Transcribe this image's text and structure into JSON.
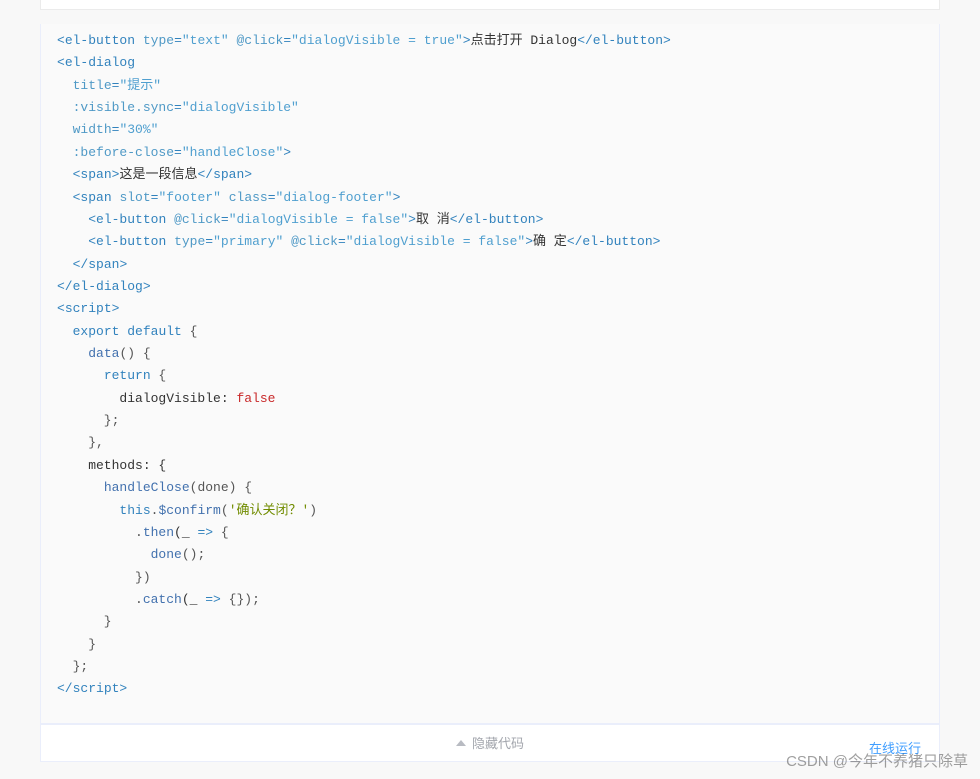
{
  "code": {
    "lines": [
      {
        "segs": [
          {
            "t": ""
          }
        ]
      },
      {
        "segs": [
          {
            "t": "<",
            "c": "tag"
          },
          {
            "t": "el-button",
            "c": "tag"
          },
          {
            "t": " "
          },
          {
            "t": "type",
            "c": "attr"
          },
          {
            "t": "=",
            "c": "tag"
          },
          {
            "t": "\"text\"",
            "c": "str"
          },
          {
            "t": " "
          },
          {
            "t": "@click",
            "c": "attr"
          },
          {
            "t": "=",
            "c": "tag"
          },
          {
            "t": "\"dialogVisible = true\"",
            "c": "str"
          },
          {
            "t": ">",
            "c": "tag"
          },
          {
            "t": "点击打开 Dialog",
            "c": "txt"
          },
          {
            "t": "</",
            "c": "tag"
          },
          {
            "t": "el-button",
            "c": "tag"
          },
          {
            "t": ">",
            "c": "tag"
          }
        ]
      },
      {
        "segs": [
          {
            "t": ""
          }
        ]
      },
      {
        "segs": [
          {
            "t": "<",
            "c": "tag"
          },
          {
            "t": "el-dialog",
            "c": "tag"
          }
        ]
      },
      {
        "segs": [
          {
            "t": "  "
          },
          {
            "t": "title",
            "c": "attr"
          },
          {
            "t": "=",
            "c": "tag"
          },
          {
            "t": "\"提示\"",
            "c": "str"
          }
        ]
      },
      {
        "segs": [
          {
            "t": "  "
          },
          {
            "t": ":visible.sync",
            "c": "attr"
          },
          {
            "t": "=",
            "c": "tag"
          },
          {
            "t": "\"dialogVisible\"",
            "c": "str"
          }
        ]
      },
      {
        "segs": [
          {
            "t": "  "
          },
          {
            "t": "width",
            "c": "attr"
          },
          {
            "t": "=",
            "c": "tag"
          },
          {
            "t": "\"30%\"",
            "c": "str"
          }
        ]
      },
      {
        "segs": [
          {
            "t": "  "
          },
          {
            "t": ":before-close",
            "c": "attr"
          },
          {
            "t": "=",
            "c": "tag"
          },
          {
            "t": "\"handleClose\"",
            "c": "str"
          },
          {
            "t": ">",
            "c": "tag"
          }
        ]
      },
      {
        "segs": [
          {
            "t": "  "
          },
          {
            "t": "<",
            "c": "tag"
          },
          {
            "t": "span",
            "c": "tag"
          },
          {
            "t": ">",
            "c": "tag"
          },
          {
            "t": "这是一段信息",
            "c": "txt"
          },
          {
            "t": "</",
            "c": "tag"
          },
          {
            "t": "span",
            "c": "tag"
          },
          {
            "t": ">",
            "c": "tag"
          }
        ]
      },
      {
        "segs": [
          {
            "t": "  "
          },
          {
            "t": "<",
            "c": "tag"
          },
          {
            "t": "span",
            "c": "tag"
          },
          {
            "t": " "
          },
          {
            "t": "slot",
            "c": "attr"
          },
          {
            "t": "=",
            "c": "tag"
          },
          {
            "t": "\"footer\"",
            "c": "str"
          },
          {
            "t": " "
          },
          {
            "t": "class",
            "c": "attr"
          },
          {
            "t": "=",
            "c": "tag"
          },
          {
            "t": "\"dialog-footer\"",
            "c": "str"
          },
          {
            "t": ">",
            "c": "tag"
          }
        ]
      },
      {
        "segs": [
          {
            "t": "    "
          },
          {
            "t": "<",
            "c": "tag"
          },
          {
            "t": "el-button",
            "c": "tag"
          },
          {
            "t": " "
          },
          {
            "t": "@click",
            "c": "attr"
          },
          {
            "t": "=",
            "c": "tag"
          },
          {
            "t": "\"dialogVisible = false\"",
            "c": "str"
          },
          {
            "t": ">",
            "c": "tag"
          },
          {
            "t": "取 消",
            "c": "txt"
          },
          {
            "t": "</",
            "c": "tag"
          },
          {
            "t": "el-button",
            "c": "tag"
          },
          {
            "t": ">",
            "c": "tag"
          }
        ]
      },
      {
        "segs": [
          {
            "t": "    "
          },
          {
            "t": "<",
            "c": "tag"
          },
          {
            "t": "el-button",
            "c": "tag"
          },
          {
            "t": " "
          },
          {
            "t": "type",
            "c": "attr"
          },
          {
            "t": "=",
            "c": "tag"
          },
          {
            "t": "\"primary\"",
            "c": "str"
          },
          {
            "t": " "
          },
          {
            "t": "@click",
            "c": "attr"
          },
          {
            "t": "=",
            "c": "tag"
          },
          {
            "t": "\"dialogVisible = false\"",
            "c": "str"
          },
          {
            "t": ">",
            "c": "tag"
          },
          {
            "t": "确 定",
            "c": "txt"
          },
          {
            "t": "</",
            "c": "tag"
          },
          {
            "t": "el-button",
            "c": "tag"
          },
          {
            "t": ">",
            "c": "tag"
          }
        ]
      },
      {
        "segs": [
          {
            "t": "  "
          },
          {
            "t": "</",
            "c": "tag"
          },
          {
            "t": "span",
            "c": "tag"
          },
          {
            "t": ">",
            "c": "tag"
          }
        ]
      },
      {
        "segs": [
          {
            "t": "</",
            "c": "tag"
          },
          {
            "t": "el-dialog",
            "c": "tag"
          },
          {
            "t": ">",
            "c": "tag"
          }
        ]
      },
      {
        "segs": [
          {
            "t": ""
          }
        ]
      },
      {
        "segs": [
          {
            "t": "<",
            "c": "tag"
          },
          {
            "t": "script",
            "c": "tag"
          },
          {
            "t": ">",
            "c": "tag"
          }
        ]
      },
      {
        "segs": [
          {
            "t": "  "
          },
          {
            "t": "export",
            "c": "kw"
          },
          {
            "t": " "
          },
          {
            "t": "default",
            "c": "kw"
          },
          {
            "t": " {",
            "c": "punc"
          }
        ]
      },
      {
        "segs": [
          {
            "t": "    "
          },
          {
            "t": "data",
            "c": "fn"
          },
          {
            "t": "() {",
            "c": "punc"
          }
        ]
      },
      {
        "segs": [
          {
            "t": "      "
          },
          {
            "t": "return",
            "c": "kw"
          },
          {
            "t": " {",
            "c": "punc"
          }
        ]
      },
      {
        "segs": [
          {
            "t": "        dialogVisible: ",
            "c": "txt"
          },
          {
            "t": "false",
            "c": "bool"
          }
        ]
      },
      {
        "segs": [
          {
            "t": "      };",
            "c": "punc"
          }
        ]
      },
      {
        "segs": [
          {
            "t": "    },",
            "c": "punc"
          }
        ]
      },
      {
        "segs": [
          {
            "t": "    methods: {",
            "c": "txt"
          }
        ]
      },
      {
        "segs": [
          {
            "t": "      "
          },
          {
            "t": "handleClose",
            "c": "fn"
          },
          {
            "t": "(done) {",
            "c": "punc"
          }
        ]
      },
      {
        "segs": [
          {
            "t": "        "
          },
          {
            "t": "this",
            "c": "kw"
          },
          {
            "t": ".",
            "c": "punc"
          },
          {
            "t": "$confirm",
            "c": "fn"
          },
          {
            "t": "(",
            "c": "punc"
          },
          {
            "t": "'确认关闭？'",
            "c": "lit"
          },
          {
            "t": ")",
            "c": "punc"
          }
        ]
      },
      {
        "segs": [
          {
            "t": "          .",
            "c": "punc"
          },
          {
            "t": "then",
            "c": "fn"
          },
          {
            "t": "(_ ",
            "c": "txt"
          },
          {
            "t": "=>",
            "c": "kw"
          },
          {
            "t": " {",
            "c": "punc"
          }
        ]
      },
      {
        "segs": [
          {
            "t": "            "
          },
          {
            "t": "done",
            "c": "fn"
          },
          {
            "t": "();",
            "c": "punc"
          }
        ]
      },
      {
        "segs": [
          {
            "t": "          })",
            "c": "punc"
          }
        ]
      },
      {
        "segs": [
          {
            "t": "          .",
            "c": "punc"
          },
          {
            "t": "catch",
            "c": "fn"
          },
          {
            "t": "(_ ",
            "c": "txt"
          },
          {
            "t": "=>",
            "c": "kw"
          },
          {
            "t": " {});",
            "c": "punc"
          }
        ]
      },
      {
        "segs": [
          {
            "t": "      }",
            "c": "punc"
          }
        ]
      },
      {
        "segs": [
          {
            "t": "    }",
            "c": "punc"
          }
        ]
      },
      {
        "segs": [
          {
            "t": "  };",
            "c": "punc"
          }
        ]
      },
      {
        "segs": [
          {
            "t": "</",
            "c": "tag"
          },
          {
            "t": "script",
            "c": "tag"
          },
          {
            "t": ">",
            "c": "tag"
          }
        ]
      }
    ]
  },
  "footer": {
    "hide_code_label": "隐藏代码",
    "run_online_label": "在线运行"
  },
  "watermark": "CSDN @今年不养猪只除草"
}
